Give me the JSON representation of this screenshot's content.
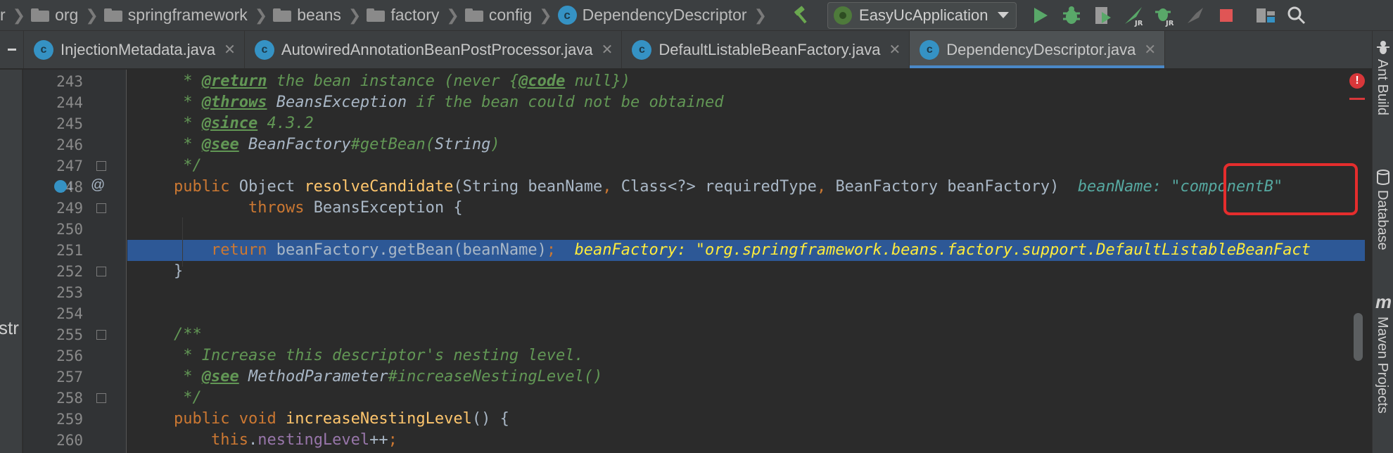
{
  "breadcrumbs": [
    {
      "label": "r",
      "type": "text"
    },
    {
      "label": "org",
      "type": "folder"
    },
    {
      "label": "springframework",
      "type": "folder"
    },
    {
      "label": "beans",
      "type": "folder"
    },
    {
      "label": "factory",
      "type": "folder"
    },
    {
      "label": "config",
      "type": "folder"
    },
    {
      "label": "DependencyDescriptor",
      "type": "class"
    }
  ],
  "toolbar": {
    "run_config": "EasyUcApplication",
    "icons": [
      "build-hammer-icon",
      "run-icon",
      "debug-icon",
      "coverage-icon",
      "jrebel-run-icon",
      "jrebel-debug-icon",
      "profile-icon",
      "stop-icon",
      "project-structure-icon",
      "search-icon"
    ],
    "colors": {
      "run": "#59a869",
      "debug": "#59a869",
      "stop": "#e05555",
      "hammer": "#6aa84f"
    }
  },
  "tabs": [
    {
      "label": "InjectionMetadata.java",
      "active": false
    },
    {
      "label": "AutowiredAnnotationBeanPostProcessor.java",
      "active": false
    },
    {
      "label": "DefaultListableBeanFactory.java",
      "active": false
    },
    {
      "label": "DependencyDescriptor.java",
      "active": true
    }
  ],
  "left_strip": {
    "text": "str"
  },
  "right_tools": [
    {
      "label": "Ant Build",
      "icon": "ant-icon"
    },
    {
      "label": "Database",
      "icon": "database-icon"
    },
    {
      "label": "Maven Projects",
      "icon": "maven-icon"
    }
  ],
  "editor": {
    "lines": [
      {
        "n": "243",
        "code": [
          [
            "doc",
            " * "
          ],
          [
            "doctag",
            "@return"
          ],
          [
            "doc",
            " the bean instance (never {"
          ],
          [
            "doctag",
            "@code"
          ],
          [
            "doc",
            " null})"
          ]
        ]
      },
      {
        "n": "244",
        "code": [
          [
            "doc",
            " * "
          ],
          [
            "doctag",
            "@throws"
          ],
          [
            "doc",
            " "
          ],
          [
            "doclink",
            "BeansException"
          ],
          [
            "doc",
            " if the bean could not be obtained"
          ]
        ]
      },
      {
        "n": "245",
        "code": [
          [
            "doc",
            " * "
          ],
          [
            "doctag",
            "@since"
          ],
          [
            "doc",
            " 4.3.2"
          ]
        ]
      },
      {
        "n": "246",
        "code": [
          [
            "doc",
            " * "
          ],
          [
            "doctag",
            "@see"
          ],
          [
            "doc",
            " "
          ],
          [
            "doclink",
            "BeanFactory"
          ],
          [
            "doc",
            "#getBean("
          ],
          [
            "doclink",
            "String"
          ],
          [
            "doc",
            ")"
          ]
        ]
      },
      {
        "n": "247",
        "code": [
          [
            "doc",
            " */"
          ]
        ]
      },
      {
        "n": "248",
        "code": [
          [
            "kw",
            "public "
          ],
          [
            "tx",
            "Object "
          ],
          [
            "fn",
            "resolveCandidate"
          ],
          [
            "tx",
            "(String beanName"
          ],
          [
            "kw",
            ", "
          ],
          [
            "tx",
            "Class<?> requiredType"
          ],
          [
            "kw",
            ", "
          ],
          [
            "tx",
            "BeanFactory beanFactory)  "
          ],
          [
            "hint",
            "beanName: "
          ],
          [
            "hint-str",
            "\"componentB\""
          ]
        ]
      },
      {
        "n": "249",
        "code": [
          [
            "tx",
            "        "
          ],
          [
            "kw",
            "throws "
          ],
          [
            "tx",
            "BeansException {"
          ]
        ]
      },
      {
        "n": "250",
        "code": []
      },
      {
        "n": "251",
        "code": [
          [
            "tx",
            "    "
          ],
          [
            "kw",
            "return "
          ],
          [
            "tx",
            "beanFactory.getBean(beanName)"
          ],
          [
            "kw",
            ";"
          ],
          [
            "tx",
            "  "
          ],
          [
            "exec-hint",
            "beanFactory: \"org.springframework.beans.factory.support.DefaultListableBeanFact"
          ]
        ]
      },
      {
        "n": "252",
        "code": [
          [
            "tx",
            "}"
          ]
        ]
      },
      {
        "n": "253",
        "code": []
      },
      {
        "n": "254",
        "code": []
      },
      {
        "n": "255",
        "code": [
          [
            "doc",
            "/**"
          ]
        ]
      },
      {
        "n": "256",
        "code": [
          [
            "doc",
            " * Increase this descriptor's nesting level."
          ]
        ]
      },
      {
        "n": "257",
        "code": [
          [
            "doc",
            " * "
          ],
          [
            "doctag",
            "@see"
          ],
          [
            "doc",
            " "
          ],
          [
            "doclink",
            "MethodParameter"
          ],
          [
            "doc",
            "#increaseNestingLevel()"
          ]
        ]
      },
      {
        "n": "258",
        "code": [
          [
            "doc",
            " */"
          ]
        ]
      },
      {
        "n": "259",
        "code": [
          [
            "kw",
            "public void "
          ],
          [
            "fn",
            "increaseNestingLevel"
          ],
          [
            "tx",
            "() {"
          ]
        ]
      },
      {
        "n": "260",
        "code": [
          [
            "tx",
            "    "
          ],
          [
            "kw",
            "this"
          ],
          [
            "tx",
            "."
          ],
          [
            "field",
            "nestingLevel"
          ],
          [
            "tx",
            "++"
          ],
          [
            "kw",
            ";"
          ]
        ]
      }
    ],
    "execution_line": "251",
    "highlighted_hint": "\"componentB\"",
    "error_marker": "!"
  }
}
